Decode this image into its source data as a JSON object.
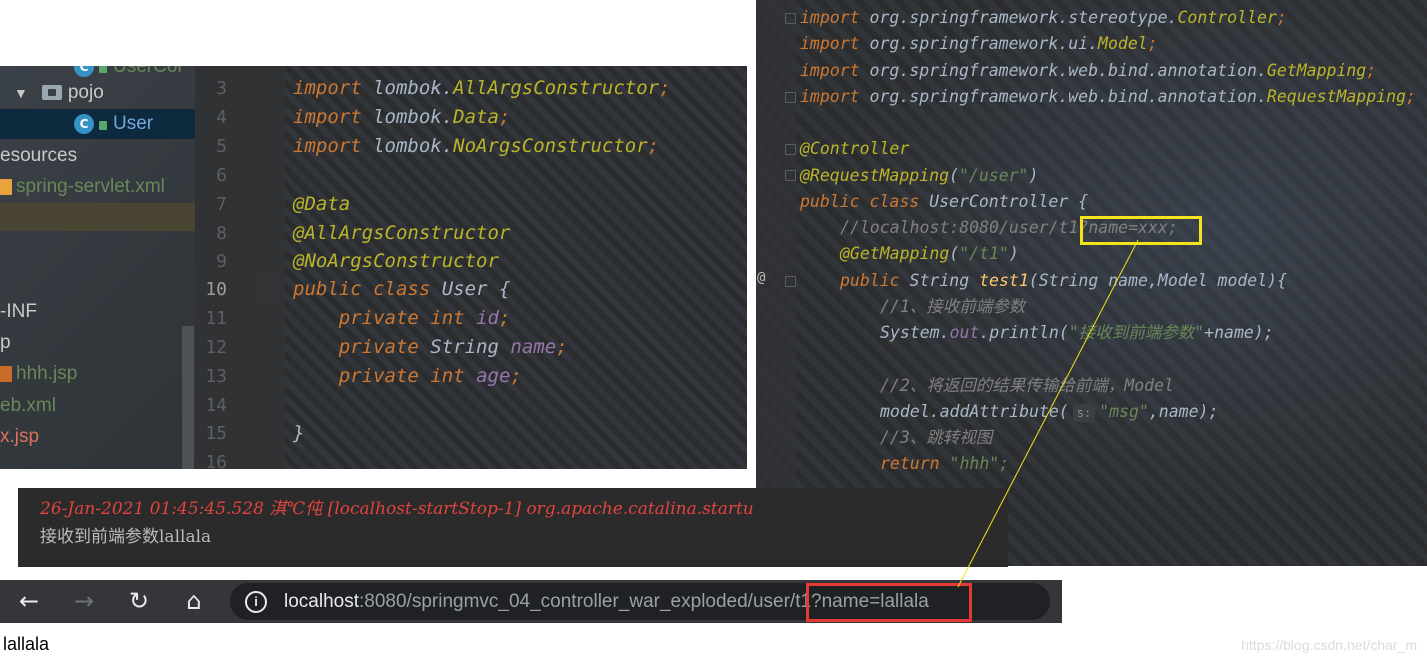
{
  "left_tree": {
    "items": [
      {
        "kind": "class",
        "text": "UserCor",
        "partial": true
      },
      {
        "kind": "folder",
        "text": "pojo"
      },
      {
        "kind": "class",
        "text": "User",
        "selected": true
      },
      {
        "kind": "plain",
        "text": "esources"
      },
      {
        "kind": "xml",
        "text": "spring-servlet.xml"
      },
      {
        "kind": "plain",
        "text": ""
      },
      {
        "kind": "plain",
        "text": "-INF"
      },
      {
        "kind": "plain",
        "text": "p"
      },
      {
        "kind": "jsp",
        "text": "hhh.jsp"
      },
      {
        "kind": "plain",
        "text": "eb.xml"
      },
      {
        "kind": "plain",
        "text": "x.jsp"
      }
    ]
  },
  "left_editor": {
    "current_line": "10",
    "line_numbers": [
      "3",
      "4",
      "5",
      "6",
      "7",
      "8",
      "9",
      "10",
      "11",
      "12",
      "13",
      "14",
      "15",
      "16"
    ],
    "lines": [
      {
        "kw": "import",
        "pk": "lombok.",
        "cls": "AllArgsConstructor",
        "end": ";"
      },
      {
        "kw": "import",
        "pk": "lombok.",
        "cls": "Data",
        "end": ";"
      },
      {
        "kw": "import",
        "pk": "lombok.",
        "cls": "NoArgsConstructor",
        "end": ";"
      },
      {
        "kw": "",
        "pk": "",
        "cls": "",
        "end": ""
      },
      {
        "an": "@Data"
      },
      {
        "an": "@AllArgsConstructor"
      },
      {
        "an": "@NoArgsConstructor"
      },
      {
        "kw": "public class",
        "pk": "",
        "cls": "User",
        "end": " {"
      },
      {
        "indent": "    ",
        "kw": "private int",
        "fld": "id",
        "end": ";"
      },
      {
        "indent": "    ",
        "kw": "private",
        "pk": "String",
        "fld": "name",
        "end": ";"
      },
      {
        "indent": "    ",
        "kw": "private int",
        "fld": "age",
        "end": ";"
      },
      {
        "kw": "",
        "pk": "",
        "cls": "",
        "end": ""
      },
      {
        "kw": "",
        "pk": "",
        "cls": "}",
        "end": ""
      },
      {
        "kw": "",
        "pk": "",
        "cls": "",
        "end": ""
      }
    ]
  },
  "right_editor": {
    "imports": [
      {
        "kw": "import",
        "pk": "org.springframework.stereotype.",
        "cls": "Controller"
      },
      {
        "kw": "import",
        "pk": "org.springframework.ui.",
        "cls": "Model"
      },
      {
        "kw": "import",
        "pk": "org.springframework.web.bind.annotation.",
        "cls": "GetMapping"
      },
      {
        "kw": "import",
        "pk": "org.springframework.web.bind.annotation.",
        "cls": "RequestMapping"
      }
    ],
    "annotation_controller": "@Controller",
    "annotation_request": "@RequestMapping",
    "request_path": "\"/user\"",
    "class_decl_kw": "public class",
    "class_decl_name": "UserController {",
    "url_comment": "//localhost:8080/user/t1?name=xxx;",
    "getmapping": "@GetMapping",
    "getmapping_path": "\"/t1\"",
    "method_kw": "public",
    "method_type": "String",
    "method_name": "test1",
    "method_params": "(String name,Model model){",
    "comment1": "//1、接收前端参数",
    "print_obj": "System.",
    "print_field": "out",
    "print_call": ".println(",
    "print_str": "\"接收到前端参数\"",
    "print_rest": "+name);",
    "comment2": "//2、将返回的结果传输给前端，Model",
    "add_attr": "model.addAttribute(",
    "param_hint": "s:",
    "attr_key": "\"msg\"",
    "attr_rest": ",name);",
    "comment3": "//3、跳转视图",
    "return_kw": "return",
    "return_val": "\"hhh\";",
    "gutter_marker": "@"
  },
  "console": {
    "line1": "26-Jan-2021 01:45:45.528 淇℃伅 [localhost-startStop-1] org.apache.catalina.startu",
    "line2": "接收到前端参数lallala"
  },
  "browser": {
    "back_icon": "←",
    "forward_icon": "→",
    "reload_icon": "↻",
    "home_icon": "⌂",
    "info_icon": "i",
    "url_host": "localhost",
    "url_rest": ":8080/springmvc_04_controller_war_exploded/user/t1?name=lallala"
  },
  "page": {
    "body_text": "lallala",
    "watermark": "https://blog.csdn.net/char_m"
  },
  "colors": {
    "highlight_yellow": "#f4e21a",
    "highlight_red": "#e53935",
    "console_red": "#e0443e"
  }
}
